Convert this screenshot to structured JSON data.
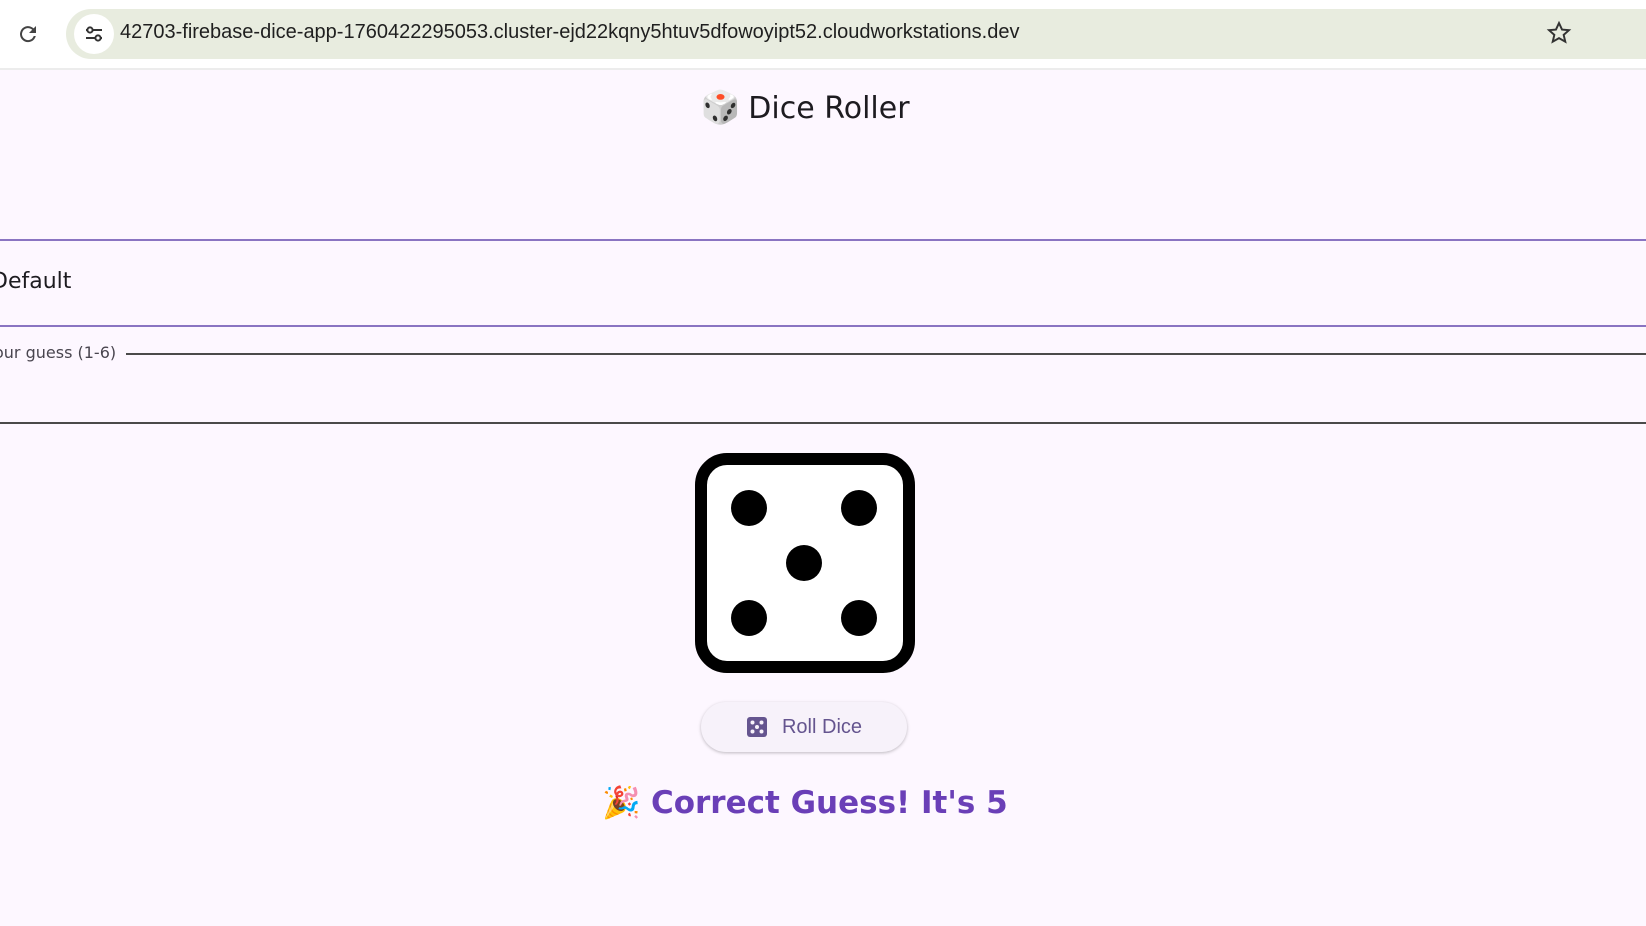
{
  "browser": {
    "url": "42703-firebase-dice-app-1760422295053.cluster-ejd22kqny5htuv5dfowoyipt52.cloudworkstations.dev"
  },
  "app": {
    "title_emoji": "🎲",
    "title": "Dice Roller",
    "dropdown_value": "Default",
    "guess_label": "our guess (1-6)",
    "die_face": 5,
    "roll_button_label": "Roll Dice",
    "result_emoji": "🎉",
    "result_text": "Correct Guess! It's 5"
  },
  "colors": {
    "background": "#fdf7ff",
    "accent": "#6a3fb7",
    "button_text": "#65558f",
    "dropdown_border": "#8a74c2"
  },
  "icons": {
    "reload": "reload-icon",
    "site_info": "tune-icon",
    "bookmark": "star-icon",
    "roll": "dice-icon"
  }
}
